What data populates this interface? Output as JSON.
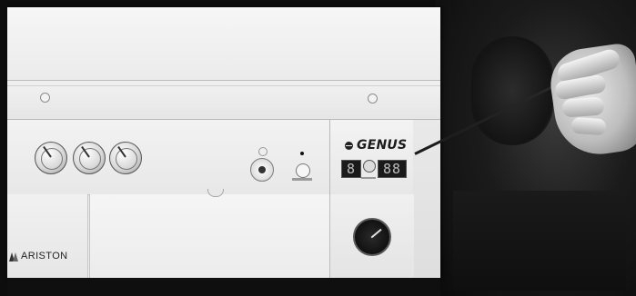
{
  "brand": {
    "model_name": "GENUS",
    "maker_logo_text": "ARISTON"
  },
  "display": {
    "left_digits": "8",
    "right_digits": "88"
  },
  "icons": {
    "brand_mark": "ariston-mark-icon",
    "model_mark": "genus-emblem-icon",
    "pressure_gauge": "pressure-gauge-icon"
  }
}
